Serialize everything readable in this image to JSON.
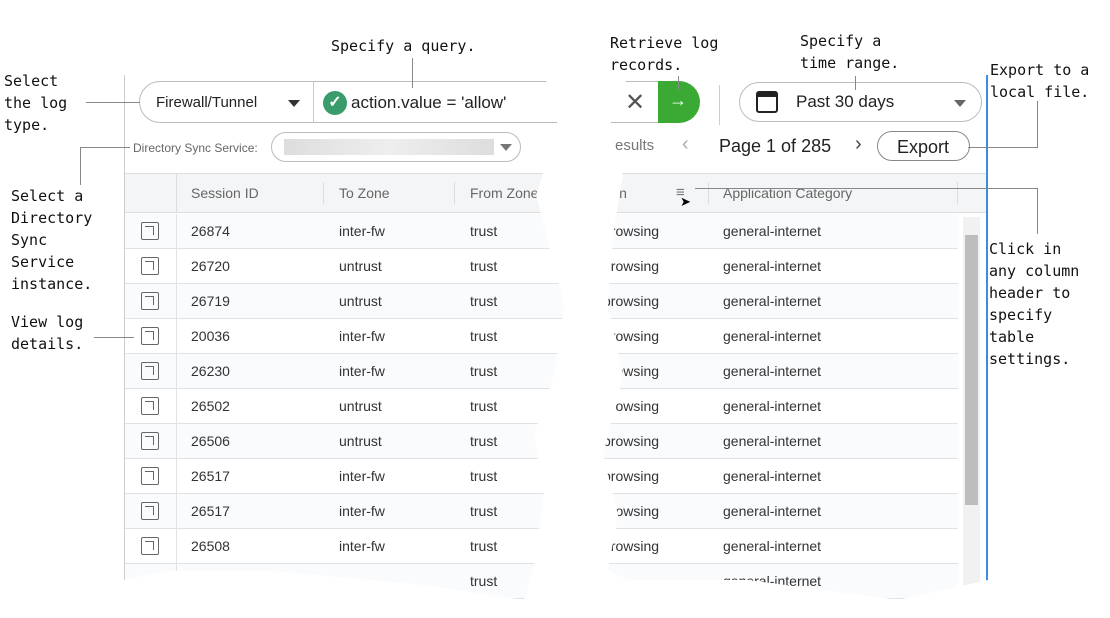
{
  "annotations": {
    "log_type": "Select\nthe log\ntype.",
    "query": "Specify a query.",
    "retrieve": "Retrieve log\nrecords.",
    "time_range": "Specify a\ntime range.",
    "export": "Export to a\nlocal file.",
    "directory": "Select a\nDirectory\nSync\nService\ninstance.",
    "view_details": "View log\ndetails.",
    "column_header": "Click in\nany column\nheader to\nspecify\ntable\nsettings."
  },
  "toolbar": {
    "log_type": "Firewall/Tunnel",
    "query": "action.value = 'allow'",
    "time_range": "Past 30 days",
    "directory_label": "Directory Sync Service:",
    "results": "results",
    "page": "Page 1 of 285",
    "export_label": "Export",
    "accent": "#3aaa35"
  },
  "columns": {
    "session_id": "Session ID",
    "to_zone": "To Zone",
    "from_zone": "From Zone",
    "action": "Action",
    "app_category": "Application Category"
  },
  "rows": [
    {
      "id": "26874",
      "to": "inter-fw",
      "from": "trust",
      "action": "browsing",
      "cat": "general-internet"
    },
    {
      "id": "26720",
      "to": "untrust",
      "from": "trust",
      "action": "browsing",
      "cat": "general-internet"
    },
    {
      "id": "26719",
      "to": "untrust",
      "from": "trust",
      "action": "browsing",
      "cat": "general-internet"
    },
    {
      "id": "20036",
      "to": "inter-fw",
      "from": "trust",
      "action": "browsing",
      "cat": "general-internet"
    },
    {
      "id": "26230",
      "to": "inter-fw",
      "from": "trust",
      "action": "browsing",
      "cat": "general-internet"
    },
    {
      "id": "26502",
      "to": "untrust",
      "from": "trust",
      "action": "browsing",
      "cat": "general-internet"
    },
    {
      "id": "26506",
      "to": "untrust",
      "from": "trust",
      "action": "browsing",
      "cat": "general-internet"
    },
    {
      "id": "26517",
      "to": "inter-fw",
      "from": "trust",
      "action": "browsing",
      "cat": "general-internet"
    },
    {
      "id": "26517",
      "to": "inter-fw",
      "from": "trust",
      "action": "browsing",
      "cat": "general-internet"
    },
    {
      "id": "26508",
      "to": "inter-fw",
      "from": "trust",
      "action": "browsing",
      "cat": "general-internet"
    },
    {
      "id": "",
      "to": "",
      "from": "trust",
      "action": "",
      "cat": "general-internet"
    }
  ]
}
